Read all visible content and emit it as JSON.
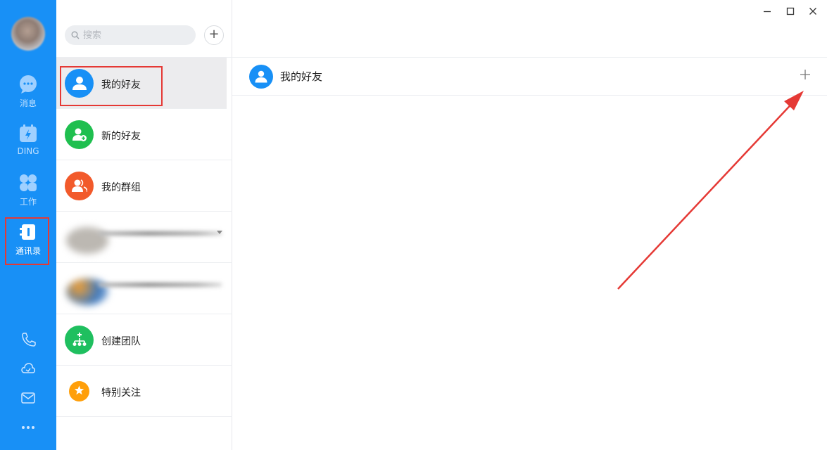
{
  "nav": {
    "items": [
      {
        "label": "消息",
        "icon": "chat-bubble-icon"
      },
      {
        "label": "DING",
        "icon": "ding-calendar-icon"
      },
      {
        "label": "工作",
        "icon": "grid-apps-icon"
      },
      {
        "label": "通讯录",
        "icon": "contacts-book-icon"
      }
    ],
    "bottom_icons": [
      "phone-icon",
      "cloud-icon",
      "mail-icon",
      "more-icon"
    ],
    "accent": "#1890f6"
  },
  "search": {
    "placeholder": "搜索"
  },
  "add_button": {
    "label": "+"
  },
  "contacts": {
    "items": [
      {
        "label": "我的好友",
        "color": "#1890f6",
        "icon": "person-icon"
      },
      {
        "label": "新的好友",
        "color": "#1fbf4f",
        "icon": "add-person-icon"
      },
      {
        "label": "我的群组",
        "color": "#f25a2b",
        "icon": "group-icon"
      },
      {
        "label": "创建团队",
        "color": "#1fbf5f",
        "icon": "org-chart-icon"
      },
      {
        "label": "特别关注",
        "color": "#ff9f0a",
        "icon": "star-icon"
      }
    ]
  },
  "panel": {
    "title": "我的好友",
    "add_label": "+"
  },
  "annotation_color": "#e53935"
}
